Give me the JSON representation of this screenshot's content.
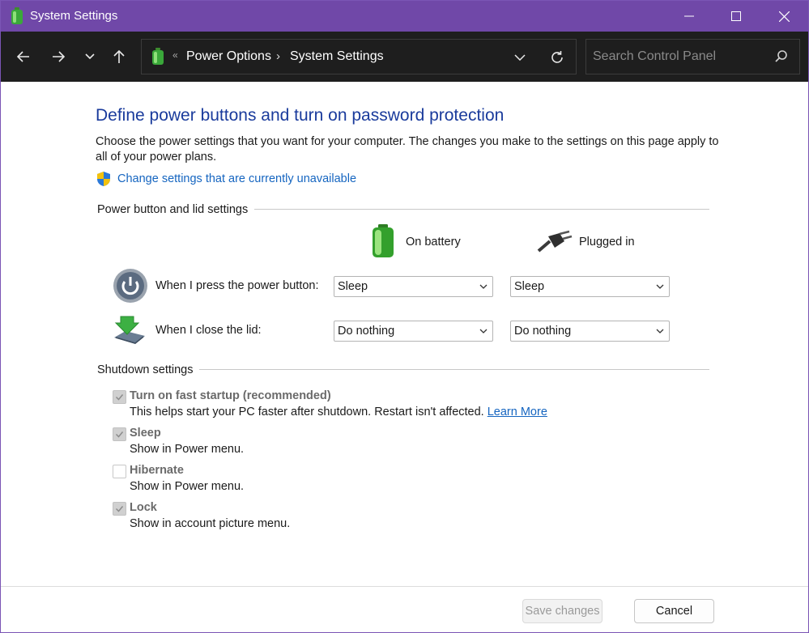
{
  "window": {
    "title": "System Settings"
  },
  "nav": {
    "address_separator": "«",
    "breadcrumbs": [
      "Power Options",
      "System Settings"
    ],
    "breadcrumb_chevron": "›",
    "search_placeholder": "Search Control Panel"
  },
  "page": {
    "heading": "Define power buttons and turn on password protection",
    "description": "Choose the power settings that you want for your computer. The changes you make to the settings on this page apply to all of your power plans.",
    "change_link": "Change settings that are currently unavailable"
  },
  "power_group": {
    "label": "Power button and lid settings",
    "columns": [
      "On battery",
      "Plugged in"
    ],
    "rows": [
      {
        "label": "When I press the power button:",
        "on_battery": "Sleep",
        "plugged_in": "Sleep",
        "icon": "power-button-icon"
      },
      {
        "label": "When I close the lid:",
        "on_battery": "Do nothing",
        "plugged_in": "Do nothing",
        "icon": "laptop-lid-icon"
      }
    ]
  },
  "shutdown_group": {
    "label": "Shutdown settings",
    "items": [
      {
        "title": "Turn on fast startup (recommended)",
        "desc": "This helps start your PC faster after shutdown. Restart isn't affected.",
        "link": "Learn More",
        "checked": true
      },
      {
        "title": "Sleep",
        "desc": "Show in Power menu.",
        "checked": true
      },
      {
        "title": "Hibernate",
        "desc": "Show in Power menu.",
        "checked": false
      },
      {
        "title": "Lock",
        "desc": "Show in account picture menu.",
        "checked": true
      }
    ]
  },
  "footer": {
    "save_label": "Save changes",
    "cancel_label": "Cancel"
  },
  "colors": {
    "titlebar": "#7048a8",
    "navbar": "#1e1e1e",
    "heading": "#1a3b9c",
    "link": "#1565c0"
  }
}
